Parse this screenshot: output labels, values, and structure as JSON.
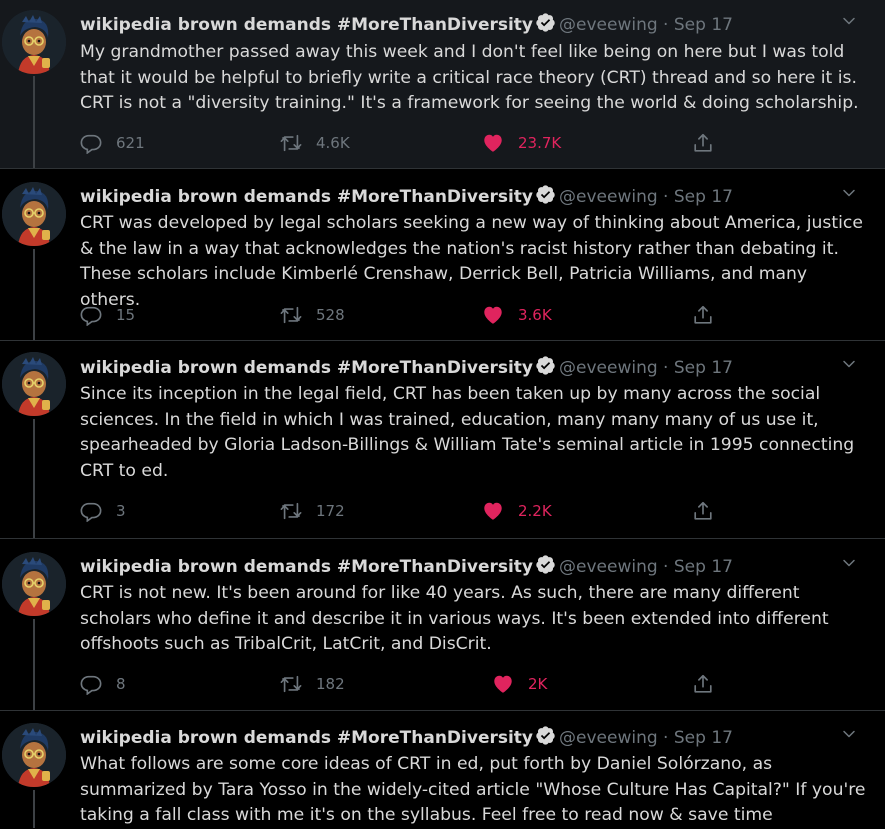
{
  "colors": {
    "background": "#000000",
    "highlight": "#15181c",
    "like": "#e0245e",
    "muted": "#6e767d",
    "verified": "#d9d9d9"
  },
  "tweets": [
    {
      "author": "wikipedia brown demands #MoreThanDiversity",
      "handle": "@eveewing",
      "date": "Sep 17",
      "text": "My grandmother passed away this week and I don't feel like being on here but I was told that it would be helpful to briefly write a critical race theory (CRT) thread and so here it is. CRT is not a \"diversity training.\" It's a framework for seeing the world & doing scholarship.",
      "replies": "621",
      "retweets": "4.6K",
      "likes": "23.7K"
    },
    {
      "author": "wikipedia brown demands #MoreThanDiversity",
      "handle": "@eveewing",
      "date": "Sep 17",
      "text": "CRT was developed by legal scholars seeking a new way of thinking about America, justice & the law in a way that acknowledges the nation's racist history rather than debating it. These scholars include Kimberlé Crenshaw, Derrick Bell, Patricia Williams, and many others.",
      "replies": "15",
      "retweets": "528",
      "likes": "3.6K"
    },
    {
      "author": "wikipedia brown demands #MoreThanDiversity",
      "handle": "@eveewing",
      "date": "Sep 17",
      "text": "Since its inception in the legal field, CRT has been taken up by many across the social sciences. In the field in which I was trained, education, many many many of us use it, spearheaded by Gloria Ladson-Billings & William Tate's seminal article in 1995 connecting CRT to ed.",
      "replies": "3",
      "retweets": "172",
      "likes": "2.2K"
    },
    {
      "author": "wikipedia brown demands #MoreThanDiversity",
      "handle": "@eveewing",
      "date": "Sep 17",
      "text": "CRT is not new. It's been around for like 40 years. As such, there are many different scholars who define it and describe it in various ways. It's been extended into different offshoots such as TribalCrit, LatCrit, and DisCrit.",
      "replies": "8",
      "retweets": "182",
      "likes": "2K"
    },
    {
      "author": "wikipedia brown demands #MoreThanDiversity",
      "handle": "@eveewing",
      "date": "Sep 17",
      "text": "What follows are some core ideas of CRT in ed, put forth by Daniel Solórzano, as summarized by Tara Yosso in the widely-cited article \"Whose Culture Has Capital?\" If you're taking a fall class with me it's on the syllabus. Feel free to read now & save time",
      "replies": "",
      "retweets": "",
      "likes": ""
    }
  ]
}
